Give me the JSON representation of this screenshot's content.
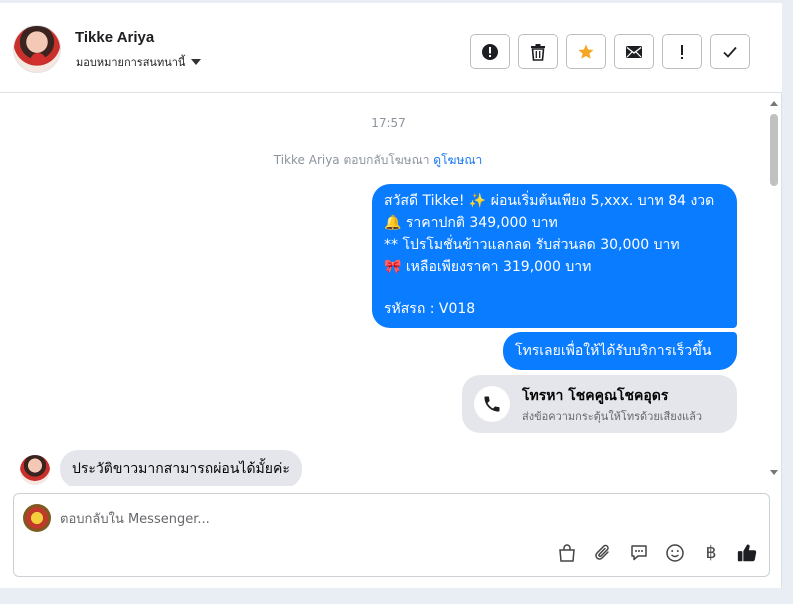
{
  "header": {
    "contact_name": "Tikke Ariya",
    "assign_label": "มอบหมายการสนทนานี้",
    "actions": [
      "mark-spam",
      "delete",
      "star",
      "mark-unread",
      "flag",
      "done"
    ]
  },
  "chat": {
    "timestamp": "17:57",
    "ad_reply": {
      "text": "Tikke Ariya ตอบกลับโฆษณา",
      "link": "ดูโฆษณา"
    },
    "outgoing_1": {
      "line1": "สวัสดี Tikke! ✨ ผ่อนเริ่มต้นเพียง 5,xxx. บาท 84 งวด",
      "line2": "🔔 ราคาปกติ 349,000 บาท",
      "line3": "** โปรโมชั่นข้าวแลกลด รับส่วนลด 30,000 บาท",
      "line4": "🎀 เหลือเพียงราคา 319,000 บาท",
      "line5": "รหัสรถ : V018"
    },
    "outgoing_2": "โทรเลยเพื่อให้ได้รับบริการเร็วขึ้น",
    "call_card": {
      "title": "โทรหา โชคคูณโชคอุดร",
      "subtitle": "ส่งข้อความกระตุ้นให้โทรด้วยเสียงแล้ว"
    },
    "incoming_1": "ประวัติขาวมากสามารถผ่อนได้มั้ยค่ะ"
  },
  "composer": {
    "placeholder": "ตอบกลับใน Messenger...",
    "currency_symbol": "฿"
  },
  "colors": {
    "outgoing_bubble": "#0a7cff",
    "incoming_bubble": "#e4e6eb",
    "star": "#f5a623",
    "link": "#1877f2"
  }
}
